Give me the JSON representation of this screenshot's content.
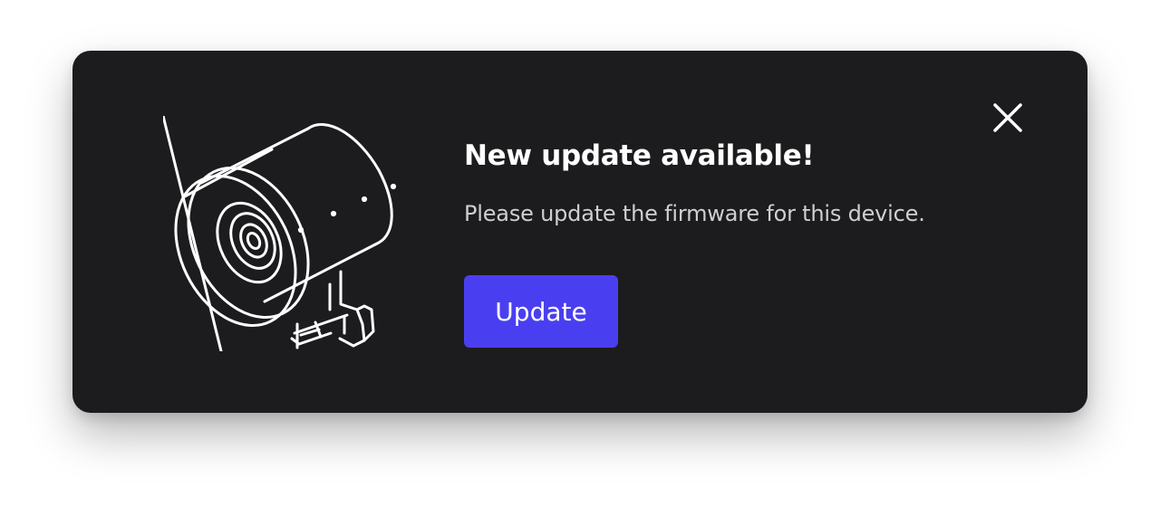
{
  "dialog": {
    "title": "New update available!",
    "message": "Please update the firmware for this device.",
    "update_label": "Update",
    "close_icon": "close-icon",
    "illustration": "camera-illustration"
  },
  "colors": {
    "dialog_background": "#1c1c1e",
    "button_accent": "#4a3ff0",
    "title_text": "#ffffff",
    "message_text": "#cfcfd3"
  }
}
